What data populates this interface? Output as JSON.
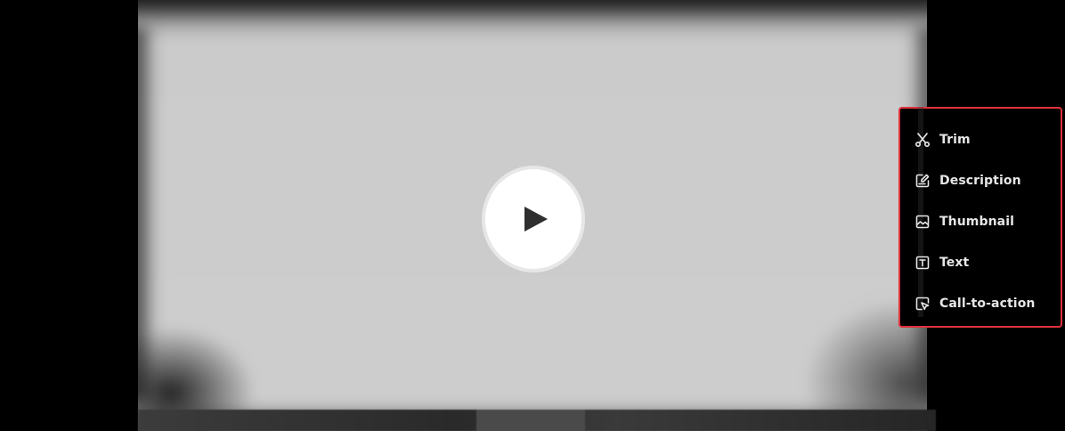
{
  "player": {
    "play_button_icon": "play-icon"
  },
  "edit_menu": {
    "accent_color": "#e0323c",
    "items": [
      {
        "label": "Trim",
        "icon": "scissors-icon"
      },
      {
        "label": "Description",
        "icon": "edit-note-icon"
      },
      {
        "label": "Thumbnail",
        "icon": "image-icon"
      },
      {
        "label": "Text",
        "icon": "text-box-icon"
      },
      {
        "label": "Call-to-action",
        "icon": "cursor-click-icon"
      }
    ]
  }
}
